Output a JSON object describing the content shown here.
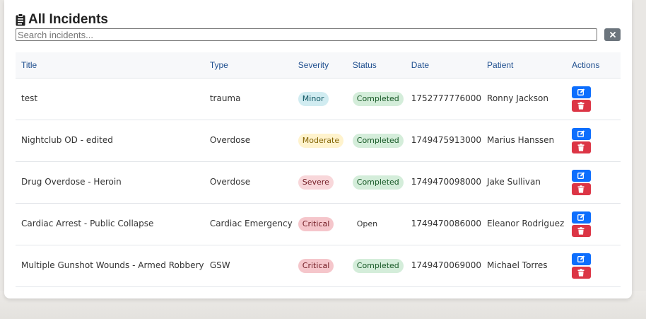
{
  "header": {
    "title": "All Incidents",
    "icon": "clipboard-icon"
  },
  "search": {
    "placeholder": "Search incidents...",
    "value": ""
  },
  "colors": {
    "edit_button": "#0d6efd",
    "delete_button": "#dc3545",
    "clear_button": "#6c757d",
    "header_text": "#1f4f8f"
  },
  "table": {
    "columns": [
      "Title",
      "Type",
      "Severity",
      "Status",
      "Date",
      "Patient",
      "Actions"
    ],
    "rows": [
      {
        "title": "test",
        "type": "trauma",
        "severity": "Minor",
        "status": "Completed",
        "date": "1752777776000",
        "patient": "Ronny Jackson"
      },
      {
        "title": "Nightclub OD - edited",
        "type": "Overdose",
        "severity": "Moderate",
        "status": "Completed",
        "date": "1749475913000",
        "patient": "Marius Hanssen"
      },
      {
        "title": "Drug Overdose - Heroin",
        "type": "Overdose",
        "severity": "Severe",
        "status": "Completed",
        "date": "1749470098000",
        "patient": "Jake Sullivan"
      },
      {
        "title": "Cardiac Arrest - Public Collapse",
        "type": "Cardiac Emergency",
        "severity": "Critical",
        "status": "Open",
        "date": "1749470086000",
        "patient": "Eleanor Rodriguez"
      },
      {
        "title": "Multiple Gunshot Wounds - Armed Robbery",
        "type": "GSW",
        "severity": "Critical",
        "status": "Completed",
        "date": "1749470069000",
        "patient": "Michael Torres"
      }
    ]
  },
  "severity_styles": {
    "Minor": {
      "bg": "#d1ecf1",
      "fg": "#0c5460"
    },
    "Moderate": {
      "bg": "#fff3cd",
      "fg": "#856404"
    },
    "Severe": {
      "bg": "#f8d7da",
      "fg": "#721c24"
    },
    "Critical": {
      "bg": "#f5c6cb",
      "fg": "#721c24"
    }
  },
  "status_styles": {
    "Completed": {
      "bg": "#d4edda",
      "fg": "#155724"
    },
    "Open": {
      "bg": "transparent",
      "fg": "#333333"
    }
  }
}
